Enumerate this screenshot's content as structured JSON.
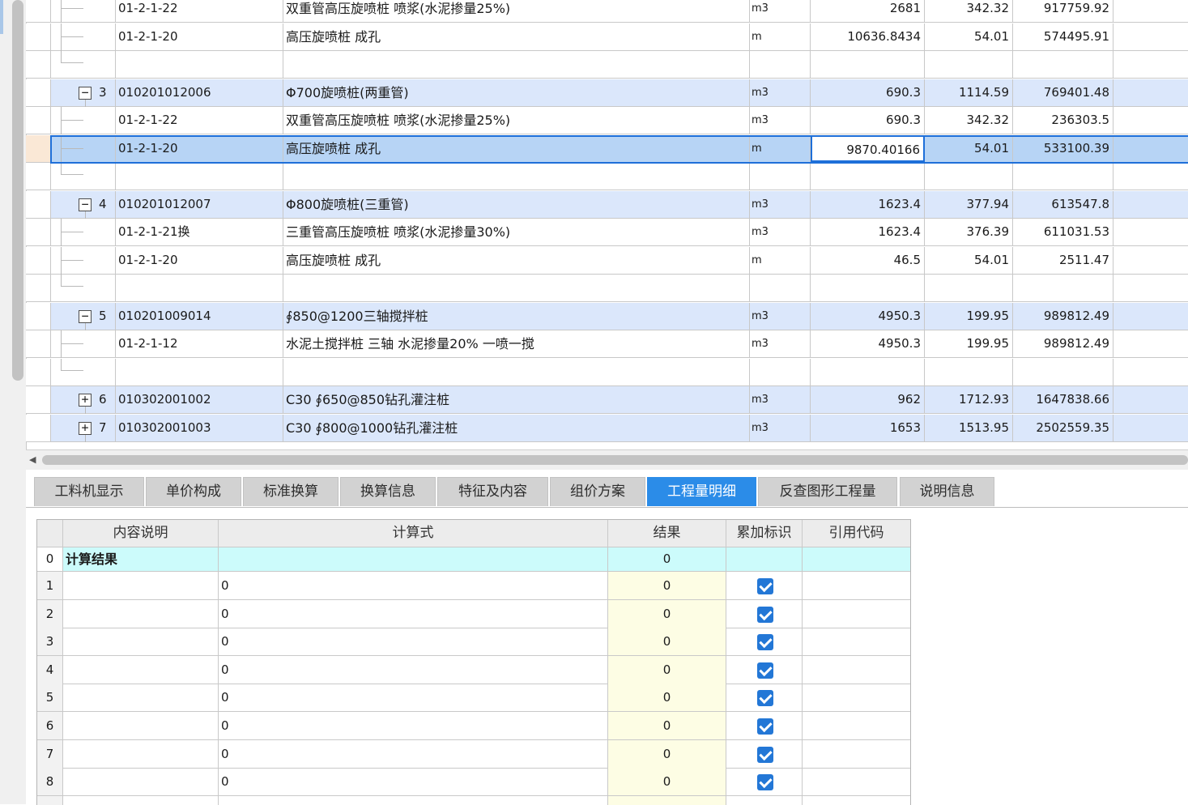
{
  "upper_rows": [
    {
      "kind": "child",
      "code": "01-2-1-22",
      "name": "双重管高压旋喷桩 喷浆(水泥掺量25%)",
      "unit": "m3",
      "qty": "2681",
      "price": "342.32",
      "total": "917759.92"
    },
    {
      "kind": "child",
      "code": "01-2-1-20",
      "name": "高压旋喷桩 成孔",
      "unit": "m",
      "qty": "10636.8434",
      "price": "54.01",
      "total": "574495.91"
    },
    {
      "kind": "blank"
    },
    {
      "kind": "parent",
      "seq": "3",
      "toggle": "−",
      "code": "010201012006",
      "name": "Φ700旋喷桩(两重管)",
      "unit": "m3",
      "qty": "690.3",
      "price": "1114.59",
      "total": "769401.48"
    },
    {
      "kind": "child",
      "code": "01-2-1-22",
      "name": "双重管高压旋喷桩 喷浆(水泥掺量25%)",
      "unit": "m3",
      "qty": "690.3",
      "price": "342.32",
      "total": "236303.5"
    },
    {
      "kind": "child",
      "selected": true,
      "code": "01-2-1-20",
      "name": "高压旋喷桩 成孔",
      "unit": "m",
      "qty": "9870.40166",
      "price": "54.01",
      "total": "533100.39"
    },
    {
      "kind": "blank"
    },
    {
      "kind": "parent",
      "seq": "4",
      "toggle": "−",
      "code": "010201012007",
      "name": "Φ800旋喷桩(三重管)",
      "unit": "m3",
      "qty": "1623.4",
      "price": "377.94",
      "total": "613547.8"
    },
    {
      "kind": "child",
      "code": "01-2-1-21换",
      "name": "三重管高压旋喷桩 喷浆(水泥掺量30%)",
      "unit": "m3",
      "qty": "1623.4",
      "price": "376.39",
      "total": "611031.53"
    },
    {
      "kind": "child",
      "code": "01-2-1-20",
      "name": "高压旋喷桩 成孔",
      "unit": "m",
      "qty": "46.5",
      "price": "54.01",
      "total": "2511.47"
    },
    {
      "kind": "blank"
    },
    {
      "kind": "parent",
      "seq": "5",
      "toggle": "−",
      "code": "010201009014",
      "name": "∮850@1200三轴搅拌桩",
      "unit": "m3",
      "qty": "4950.3",
      "price": "199.95",
      "total": "989812.49"
    },
    {
      "kind": "child",
      "code": "01-2-1-12",
      "name": "水泥土搅拌桩 三轴 水泥掺量20% 一喷一搅",
      "unit": "m3",
      "qty": "4950.3",
      "price": "199.95",
      "total": "989812.49"
    },
    {
      "kind": "blank"
    },
    {
      "kind": "parent",
      "seq": "6",
      "toggle": "+",
      "code": "010302001002",
      "name": "C30 ∮650@850钻孔灌注桩",
      "unit": "m3",
      "qty": "962",
      "price": "1712.93",
      "total": "1647838.66"
    },
    {
      "kind": "parent",
      "seq": "7",
      "toggle": "+",
      "code": "010302001003",
      "name": "C30 ∮800@1000钻孔灌注桩",
      "unit": "m3",
      "qty": "1653",
      "price": "1513.95",
      "total": "2502559.35"
    }
  ],
  "tabs": [
    {
      "label": "工料机显示"
    },
    {
      "label": "单价构成"
    },
    {
      "label": "标准换算"
    },
    {
      "label": "换算信息"
    },
    {
      "label": "特征及内容"
    },
    {
      "label": "组价方案"
    },
    {
      "label": "工程量明细",
      "active": true
    },
    {
      "label": "反查图形工程量"
    },
    {
      "label": "说明信息"
    }
  ],
  "detail_grid": {
    "headers": {
      "desc": "内容说明",
      "formula": "计算式",
      "result": "结果",
      "accumulate": "累加标识",
      "ref_code": "引用代码"
    },
    "summary": {
      "index": "0",
      "desc": "计算结果",
      "result": "0"
    },
    "rows": [
      {
        "index": "1",
        "formula": "0",
        "result": "0",
        "accumulate": true
      },
      {
        "index": "2",
        "formula": "0",
        "result": "0",
        "accumulate": true
      },
      {
        "index": "3",
        "formula": "0",
        "result": "0",
        "accumulate": true
      },
      {
        "index": "4",
        "formula": "0",
        "result": "0",
        "accumulate": true
      },
      {
        "index": "5",
        "formula": "0",
        "result": "0",
        "accumulate": true
      },
      {
        "index": "6",
        "formula": "0",
        "result": "0",
        "accumulate": true
      },
      {
        "index": "7",
        "formula": "0",
        "result": "0",
        "accumulate": true
      },
      {
        "index": "8",
        "formula": "0",
        "result": "0",
        "accumulate": true
      }
    ]
  },
  "colors": {
    "accent": "#2b8ce8",
    "selected_row": "#b7d4f5",
    "parent_row": "#dbe7fb",
    "summary_row": "#ccfbfb",
    "result_cell": "#fdfde4"
  }
}
